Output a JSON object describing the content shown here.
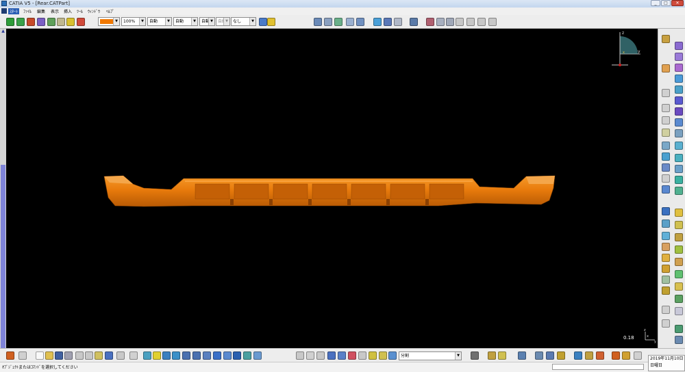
{
  "window": {
    "title": "CATIA V5 - [Rear.CATPart]",
    "controls": [
      "_",
      "□",
      "✕"
    ]
  },
  "menu": {
    "items": [
      {
        "label": "ｽﾀｰﾄ",
        "active": true
      },
      {
        "label": "ﾌｧｲﾙ"
      },
      {
        "label": "編集"
      },
      {
        "label": "表示"
      },
      {
        "label": "挿入"
      },
      {
        "label": "ﾂｰﾙ"
      },
      {
        "label": "ｳｨﾝﾄﾞｳ"
      },
      {
        "label": "ﾍﾙﾌﾟ"
      }
    ]
  },
  "toolbar": {
    "color_swatch": "#f07800",
    "opacity": "100%",
    "line_thickness": "自動",
    "line_type": "自動",
    "point_symbol": "自動",
    "layer_label": "自線",
    "layer": "なし"
  },
  "bottom_toolbar": {
    "render_style": "分割"
  },
  "status": {
    "message": "ｵﾌﾞｼﾞｪｸﾄまたはｺﾏﾝﾄﾞを選択してください"
  },
  "clock": {
    "date": "2019年11月10日",
    "weekday": "日曜日"
  },
  "viewport": {
    "scale": "0.18",
    "axes": {
      "z": "z",
      "y": "y",
      "x": "x"
    },
    "part_color": "#e87b0c"
  }
}
